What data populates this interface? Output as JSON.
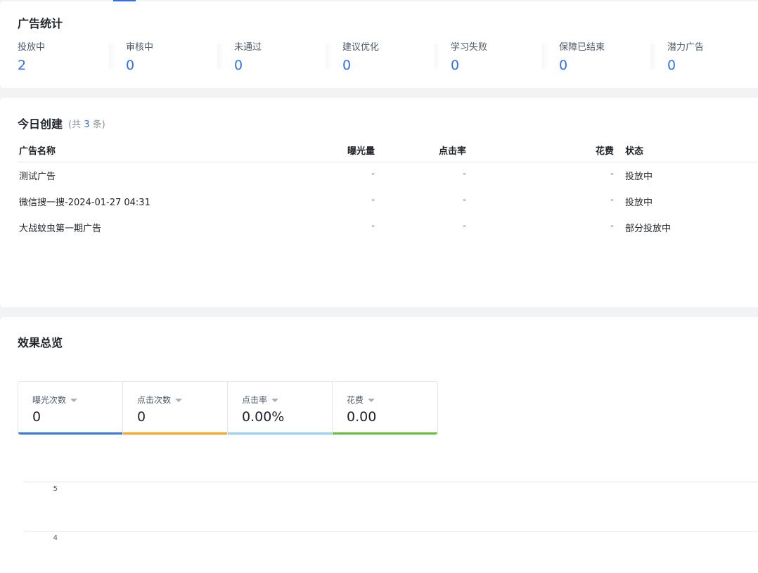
{
  "stats": {
    "title": "广告统计",
    "items": [
      {
        "label": "投放中",
        "value": "2"
      },
      {
        "label": "审核中",
        "value": "0"
      },
      {
        "label": "未通过",
        "value": "0"
      },
      {
        "label": "建议优化",
        "value": "0"
      },
      {
        "label": "学习失败",
        "value": "0"
      },
      {
        "label": "保障已结束",
        "value": "0"
      },
      {
        "label": "潜力广告",
        "value": "0"
      }
    ]
  },
  "today": {
    "title": "今日创建",
    "count_prefix": "(共 ",
    "count": "3",
    "count_suffix": " 条)",
    "columns": {
      "name": "广告名称",
      "impressions": "曝光量",
      "ctr": "点击率",
      "cost": "花费",
      "status": "状态"
    },
    "rows": [
      {
        "name": "测试广告",
        "impressions": "-",
        "ctr": "-",
        "cost": "-",
        "status": "投放中"
      },
      {
        "name": "微信搜一搜-2024-01-27 04:31",
        "impressions": "-",
        "ctr": "-",
        "cost": "-",
        "status": "投放中"
      },
      {
        "name": "大战蚊虫第一期广告",
        "impressions": "-",
        "ctr": "-",
        "cost": "-",
        "status": "部分投放中"
      }
    ]
  },
  "overview": {
    "title": "效果总览",
    "metrics": [
      {
        "label": "曝光次数",
        "value": "0",
        "color": "#3a7bd5"
      },
      {
        "label": "点击次数",
        "value": "0",
        "color": "#f5a623"
      },
      {
        "label": "点击率",
        "value": "0.00%",
        "color": "#9fd3f2"
      },
      {
        "label": "花费",
        "value": "0.00",
        "color": "#67c23a"
      }
    ],
    "chart_data": {
      "type": "line",
      "title": "",
      "xlabel": "",
      "ylabel": "",
      "y_ticks": [
        "5",
        "4"
      ],
      "series": []
    }
  }
}
